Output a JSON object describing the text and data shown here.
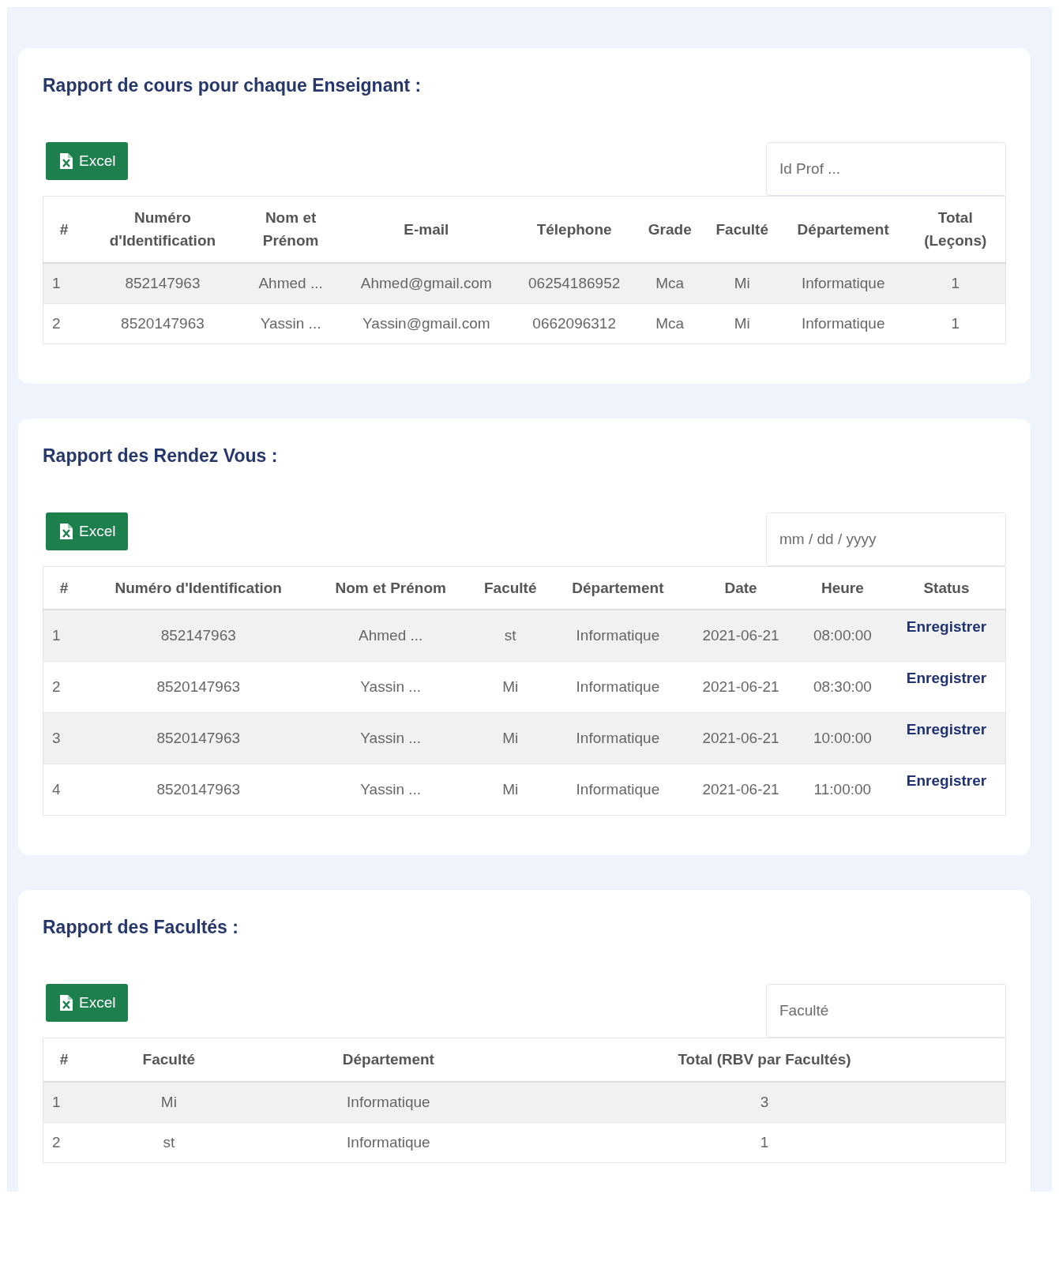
{
  "sections": [
    {
      "title": "Rapport de cours pour chaque Enseignant :",
      "export_button": "Excel",
      "filter": {
        "placeholder": "Id Prof ..."
      },
      "columns": [
        {
          "label": "#",
          "kind": "index"
        },
        {
          "label": "Numéro d'Identification",
          "kind": "text"
        },
        {
          "label": "Nom et Prénom",
          "kind": "text"
        },
        {
          "label": "E-mail",
          "kind": "text"
        },
        {
          "label": "Télephone",
          "kind": "text"
        },
        {
          "label": "Grade",
          "kind": "text"
        },
        {
          "label": "Faculté",
          "kind": "text"
        },
        {
          "label": "Département",
          "kind": "text"
        },
        {
          "label": "Total (Leçons)",
          "kind": "text"
        }
      ],
      "rows": [
        [
          "1",
          "852147963",
          "Ahmed ...",
          "Ahmed@gmail.com",
          "06254186952",
          "Mca",
          "Mi",
          "Informatique",
          "1"
        ],
        [
          "2",
          "8520147963",
          "Yassin ...",
          "Yassin@gmail.com",
          "0662096312",
          "Mca",
          "Mi",
          "Informatique",
          "1"
        ]
      ]
    },
    {
      "title": "Rapport des Rendez Vous :",
      "export_button": "Excel",
      "filter": {
        "placeholder": "mm / dd / yyyy"
      },
      "columns": [
        {
          "label": "#",
          "kind": "index"
        },
        {
          "label": "Numéro d'Identification",
          "kind": "text"
        },
        {
          "label": "Nom et Prénom",
          "kind": "text"
        },
        {
          "label": "Faculté",
          "kind": "text"
        },
        {
          "label": "Département",
          "kind": "text"
        },
        {
          "label": "Date",
          "kind": "text"
        },
        {
          "label": "Heure",
          "kind": "text"
        },
        {
          "label": "Status",
          "kind": "status"
        }
      ],
      "rows": [
        [
          "1",
          "852147963",
          "Ahmed ...",
          "st",
          "Informatique",
          "2021-06-21",
          "08:00:00",
          "Enregistrer"
        ],
        [
          "2",
          "8520147963",
          "Yassin ...",
          "Mi",
          "Informatique",
          "2021-06-21",
          "08:30:00",
          "Enregistrer"
        ],
        [
          "3",
          "8520147963",
          "Yassin ...",
          "Mi",
          "Informatique",
          "2021-06-21",
          "10:00:00",
          "Enregistrer"
        ],
        [
          "4",
          "8520147963",
          "Yassin ...",
          "Mi",
          "Informatique",
          "2021-06-21",
          "11:00:00",
          "Enregistrer"
        ]
      ]
    },
    {
      "title": "Rapport des Facultés :",
      "export_button": "Excel",
      "filter": {
        "placeholder": "Faculté"
      },
      "columns": [
        {
          "label": "#",
          "kind": "index"
        },
        {
          "label": "Faculté",
          "kind": "text"
        },
        {
          "label": "Département",
          "kind": "text"
        },
        {
          "label": "Total (RBV par Facultés)",
          "kind": "text"
        }
      ],
      "rows": [
        [
          "1",
          "Mi",
          "Informatique",
          "3"
        ],
        [
          "2",
          "st",
          "Informatique",
          "1"
        ]
      ]
    }
  ]
}
